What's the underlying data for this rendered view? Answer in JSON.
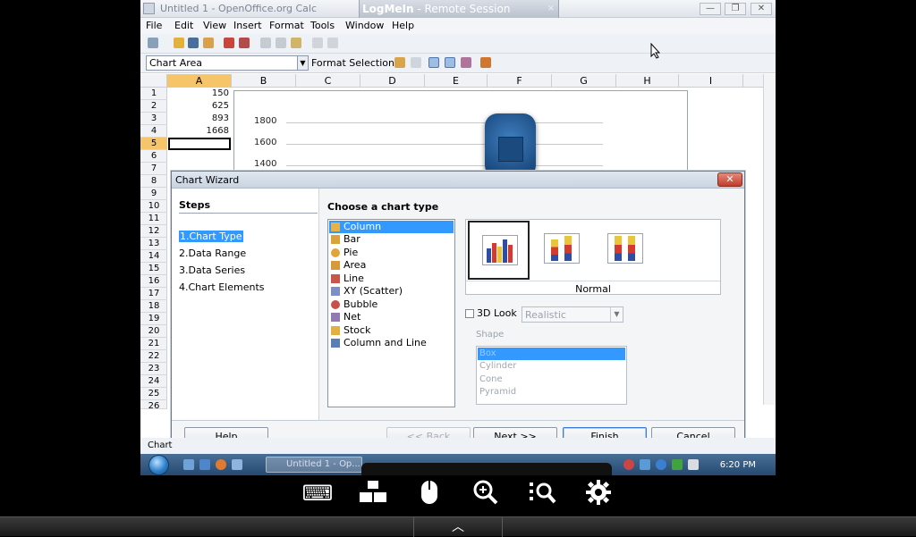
{
  "window": {
    "title": "Untitled 1 - OpenOffice.org Calc",
    "min_glyph": "—",
    "max_glyph": "❐",
    "close_glyph": "✕"
  },
  "remote": {
    "brand": "LogMeIn",
    "session": " - Remote Session",
    "close_glyph": "×"
  },
  "menu": [
    "File",
    "Edit",
    "View",
    "Insert",
    "Format",
    "Tools",
    "Window",
    "Help"
  ],
  "formula_bar": {
    "namebox": "Chart Area",
    "format_selection": "Format Selection"
  },
  "sheet": {
    "columns": [
      "A",
      "B",
      "C",
      "D",
      "E",
      "F",
      "G",
      "H",
      "I"
    ],
    "rows": [
      "1",
      "2",
      "3",
      "4",
      "5",
      "6",
      "7",
      "8",
      "9",
      "10",
      "11",
      "12",
      "13",
      "14",
      "15",
      "16",
      "17",
      "18",
      "19",
      "20",
      "21",
      "22",
      "23",
      "24",
      "25",
      "26"
    ],
    "cells": [
      "150",
      "625",
      "893",
      "1668"
    ],
    "chart_ticks": [
      "1800",
      "1600",
      "1400"
    ]
  },
  "dialog": {
    "title": "Chart Wizard",
    "close_glyph": "✕",
    "steps_title": "Steps",
    "steps": [
      "1.Chart Type",
      "2.Data Range",
      "3.Data Series",
      "4.Chart Elements"
    ],
    "choose_title": "Choose a chart type",
    "chart_types": [
      "Column",
      "Bar",
      "Pie",
      "Area",
      "Line",
      "XY (Scatter)",
      "Bubble",
      "Net",
      "Stock",
      "Column and Line"
    ],
    "selected_type": "Column",
    "variant_label": "Normal",
    "look_3d_label": "3D Look",
    "look_3d_value": "Realistic",
    "shape_label": "Shape",
    "shapes": [
      "Box",
      "Cylinder",
      "Cone",
      "Pyramid"
    ],
    "buttons": {
      "help": "Help",
      "back": "<< Back",
      "next": "Next >>",
      "finish": "Finish",
      "cancel": "Cancel"
    }
  },
  "statusbar": {
    "text": "Chart"
  },
  "taskbar": {
    "task_item": "Untitled 1 - Op...",
    "clock": "6:20 PM"
  },
  "controls": {
    "keyboard_glyph": "⌨",
    "up_glyph": "︿"
  },
  "colors": {
    "selection": "#3399ff",
    "dialog_close": "#c23c2a",
    "taskbar": "#254a71"
  }
}
